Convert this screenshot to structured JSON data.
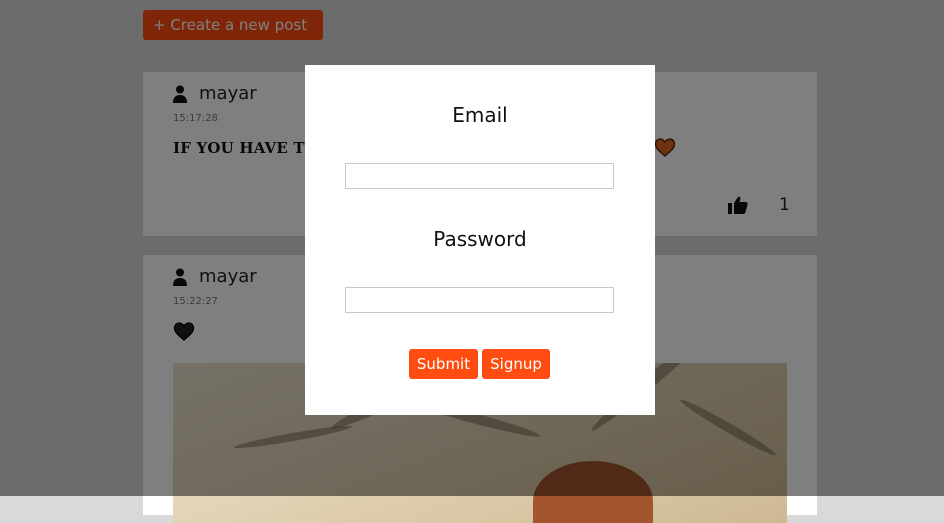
{
  "toolbar": {
    "create_post_label": "+ Create a new post"
  },
  "posts": [
    {
      "author": "mayar",
      "time": "15:17:28",
      "text": "IF YOU HAVE TH",
      "heart_color": "#e0631e",
      "like_count": "1"
    },
    {
      "author": "mayar",
      "time": "15:22:27",
      "heart_color": "#222222"
    }
  ],
  "login_modal": {
    "email_label": "Email",
    "email_value": "",
    "password_label": "Password",
    "password_value": "",
    "submit_label": "Submit",
    "signup_label": "Signup"
  },
  "colors": {
    "accent": "#ff4d12",
    "overlay": "rgba(0,0,0,0.5)"
  }
}
